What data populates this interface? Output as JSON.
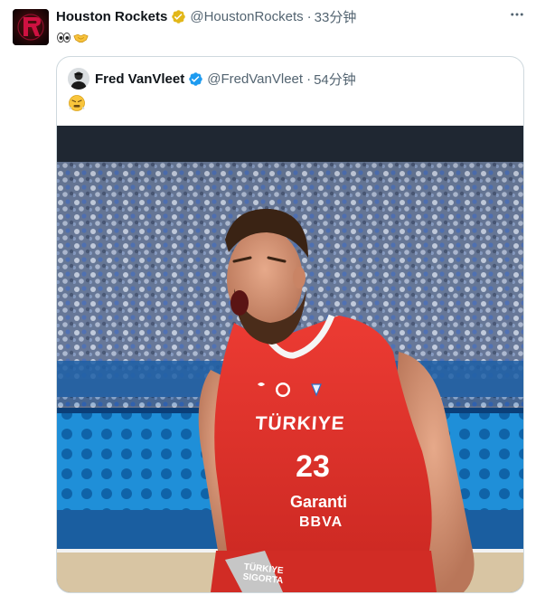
{
  "tweet": {
    "author": "Houston Rockets",
    "handle": "@HoustonRockets",
    "separator": "·",
    "time": "33分钟",
    "text_emojis": [
      "eyes",
      "handshake"
    ],
    "more_label": "···"
  },
  "quoted": {
    "author": "Fred VanVleet",
    "handle": "@FredVanVleet",
    "separator": "·",
    "time": "54分钟",
    "text_emoji": "steam-from-nose-face"
  },
  "photo": {
    "jersey_country": "TÜRKIYE",
    "jersey_number": "23",
    "jersey_sponsor_1": "Garanti",
    "jersey_sponsor_2": "BBVA",
    "shorts_sponsor": "TÜRKIYE SIGORTA"
  },
  "colors": {
    "verified_gold": "#e2b719",
    "verified_blue": "#1d9bf0",
    "jersey_red": "#e1332b",
    "text_secondary": "#536471"
  }
}
